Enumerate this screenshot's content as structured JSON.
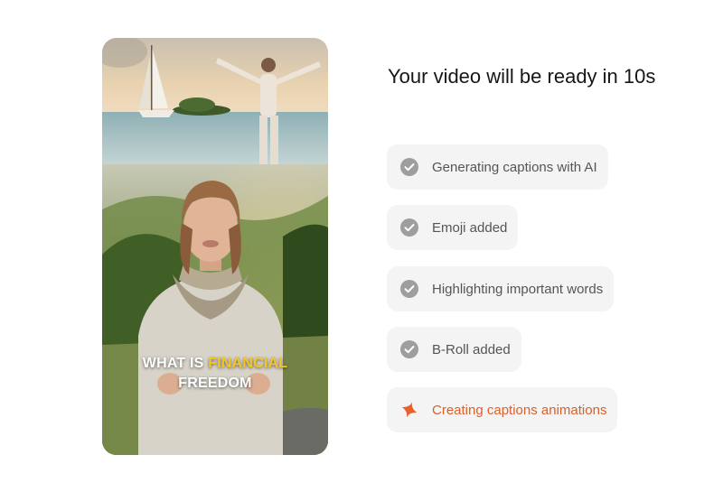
{
  "video": {
    "caption_prefix": "WHAT IS ",
    "caption_highlight": "FINANCIAL",
    "caption_line2": "FREEDOM",
    "highlight_color": "#f5c524"
  },
  "status": {
    "title": "Your video will be ready in 10s"
  },
  "steps": [
    {
      "label": "Generating captions with AI",
      "state": "done",
      "icon": "check-circle-icon"
    },
    {
      "label": "Emoji added",
      "state": "done",
      "icon": "check-circle-icon"
    },
    {
      "label": "Highlighting important words",
      "state": "done",
      "icon": "check-circle-icon"
    },
    {
      "label": "B-Roll added",
      "state": "done",
      "icon": "check-circle-icon"
    },
    {
      "label": "Creating captions animations",
      "state": "in-progress",
      "icon": "sparkle-icon"
    }
  ],
  "colors": {
    "done_icon": "#9e9e9e",
    "active": "#d9602b",
    "step_bg": "#f4f4f4"
  }
}
